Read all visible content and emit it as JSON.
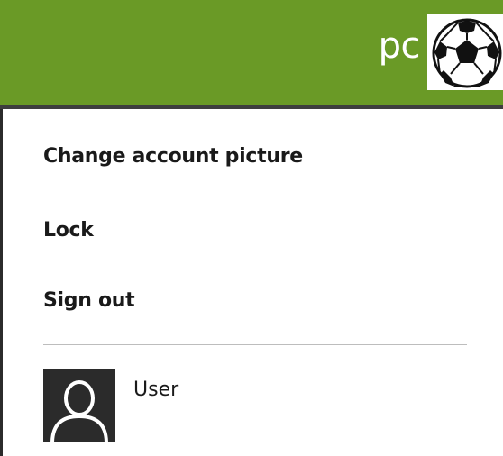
{
  "header": {
    "account_name": "pc",
    "background_color": "#6a9a26",
    "avatar_icon": "soccer-ball-icon"
  },
  "menu": {
    "items": [
      {
        "label": "Change account picture"
      },
      {
        "label": "Lock"
      },
      {
        "label": "Sign out"
      }
    ]
  },
  "other_users": [
    {
      "name": "User",
      "avatar_icon": "default-user-icon"
    }
  ]
}
